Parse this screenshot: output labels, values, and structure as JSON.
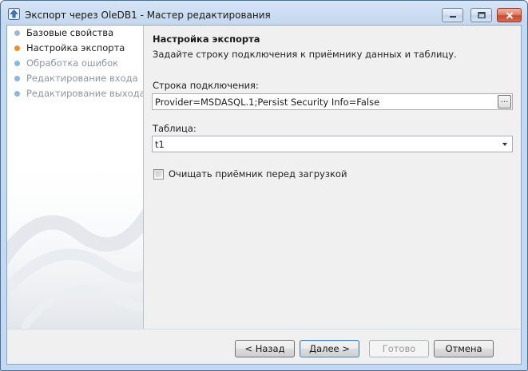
{
  "window": {
    "title": "Экспорт через OleDB1 - Мастер редактирования",
    "icons": [
      "app-icon",
      "minimize-icon",
      "maximize-icon",
      "close-icon"
    ]
  },
  "steps": [
    {
      "label": "Базовые свойства",
      "state": "done",
      "dot_color": "#a0b6cc"
    },
    {
      "label": "Настройка экспорта",
      "state": "current",
      "dot_color": "#f28c28"
    },
    {
      "label": "Обработка ошибок",
      "state": "pending",
      "dot_color": "#8cb4e0"
    },
    {
      "label": "Редактирование входа",
      "state": "pending",
      "dot_color": "#8cb4e0"
    },
    {
      "label": "Редактирование выхода",
      "state": "pending",
      "dot_color": "#8cb4e0"
    }
  ],
  "colors": {
    "step_done_text": "#1e1e1e",
    "step_pending_text": "#8f96a0"
  },
  "page": {
    "title": "Настройка экспорта",
    "subtitle": "Задайте строку подключения к приёмнику данных и таблицу."
  },
  "connection": {
    "label": "Строка подключения:",
    "value": "Provider=MSDASQL.1;Persist Security Info=False",
    "browse_label": "..."
  },
  "table": {
    "label": "Таблица:",
    "value": "t1"
  },
  "clear_target": {
    "label": "Очищать приёмник перед загрузкой",
    "checked": false
  },
  "buttons": {
    "back": "< Назад",
    "next": "Далее >",
    "finish": "Готово",
    "cancel": "Отмена"
  }
}
